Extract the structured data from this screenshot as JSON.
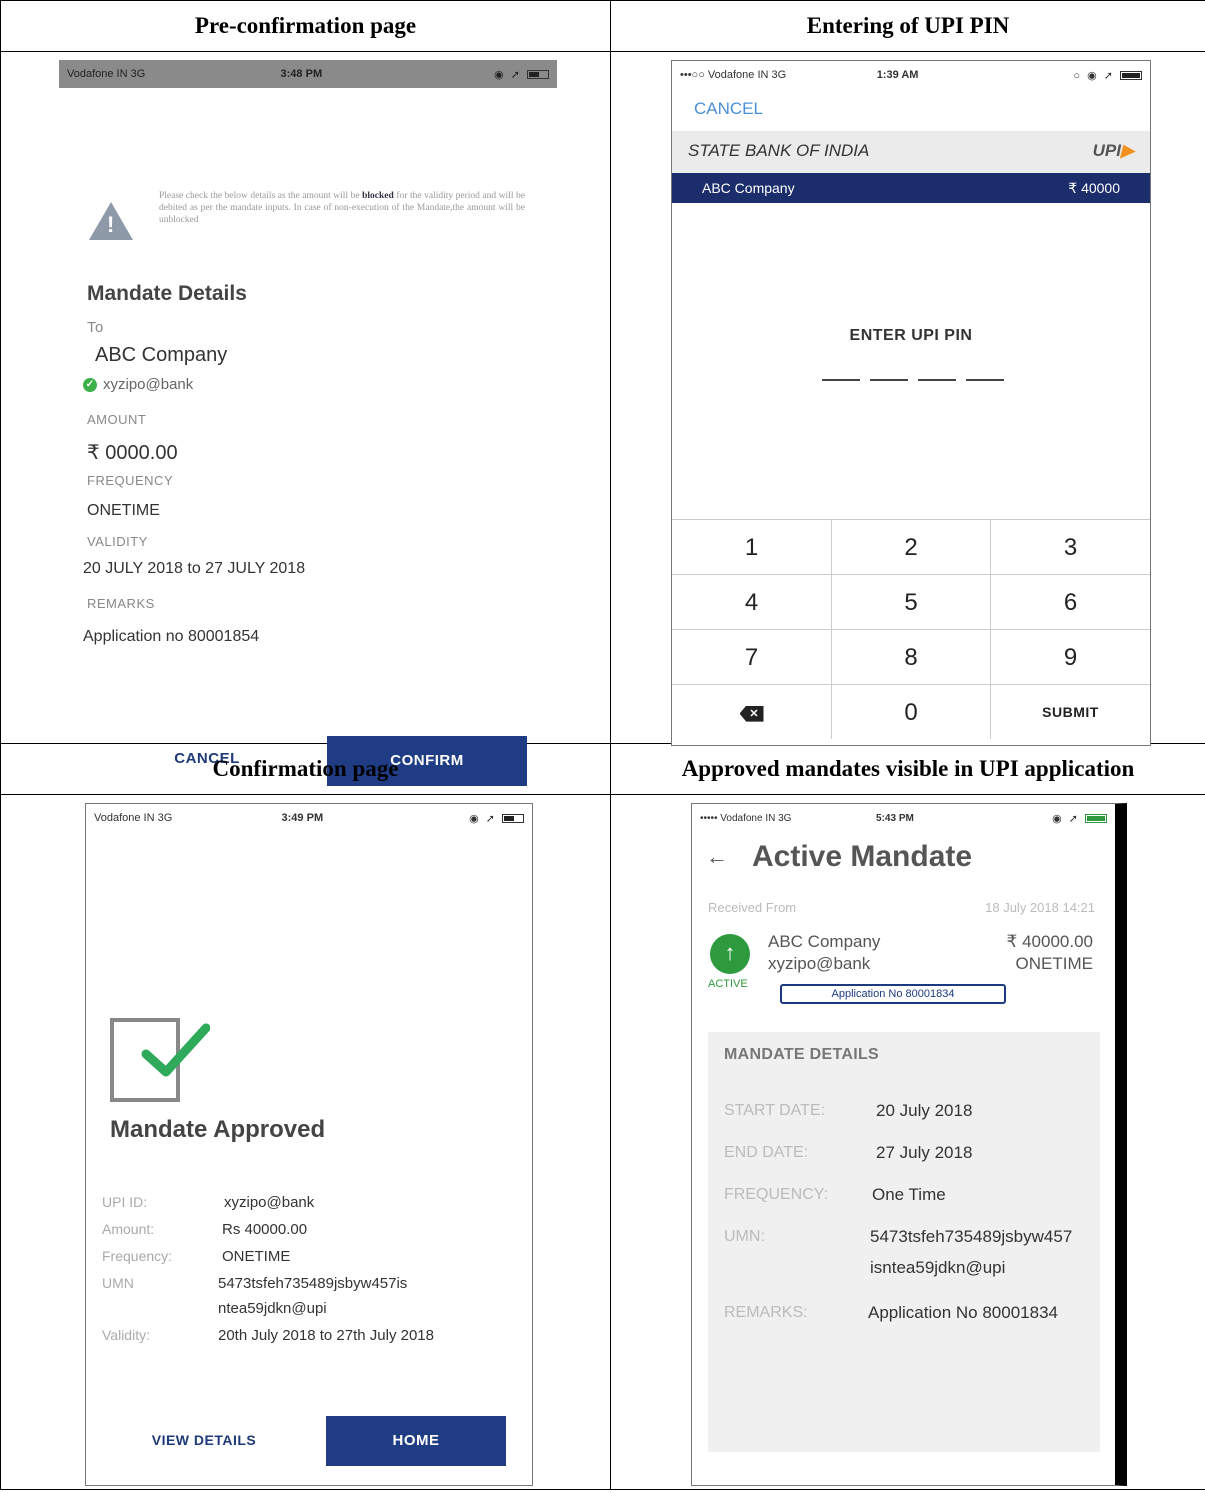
{
  "headers": {
    "pre_confirmation": "Pre-confirmation page",
    "upi_pin": "Entering of UPI PIN",
    "confirmation": "Confirmation page",
    "approved": "Approved mandates visible in UPI application"
  },
  "pre_confirmation": {
    "status": {
      "carrier": "Vodafone IN  3G",
      "time": "3:48 PM"
    },
    "warning_pre": "Please check the below details as the amount will be ",
    "warning_bold": "blocked",
    "warning_post": " for the validity period and will be debited as per the mandate inputs. In case of non-execution of the Mandate,the amount will be unblocked",
    "title": "Mandate Details",
    "to_label": "To",
    "to_value": "ABC Company",
    "vpa": "xyzipo@bank",
    "amount_label": "AMOUNT",
    "amount_value": "₹ 0000.00",
    "frequency_label": "FREQUENCY",
    "frequency_value": "ONETIME",
    "validity_label": "VALIDITY",
    "validity_value": "20 JULY 2018 to 27 JULY 2018",
    "remarks_label": "REMARKS",
    "remarks_value": "Application no 80001854",
    "cancel": "CANCEL",
    "confirm": "CONFIRM"
  },
  "upi_pin": {
    "status": {
      "carrier": "•••○○ Vodafone IN  3G",
      "time": "1:39 AM"
    },
    "cancel": "CANCEL",
    "bank": "STATE BANK OF INDIA",
    "upi_logo": "UPI",
    "payee": "ABC Company",
    "amount": "₹ 40000",
    "enter_pin": "ENTER UPI PIN",
    "keys": [
      "1",
      "2",
      "3",
      "4",
      "5",
      "6",
      "7",
      "8",
      "9",
      "",
      "0",
      "SUBMIT"
    ]
  },
  "confirmation": {
    "status": {
      "carrier": "Vodafone IN  3G",
      "time": "3:49 PM"
    },
    "title": "Mandate Approved",
    "rows": [
      {
        "k": "UPI ID:",
        "v": "xyzipo@bank"
      },
      {
        "k": "Amount:",
        "v": "Rs 40000.00"
      },
      {
        "k": "Frequency:",
        "v": "ONETIME"
      },
      {
        "k": "UMN",
        "v": "5473tsfeh735489jsbyw457is"
      },
      {
        "k": "",
        "v": "ntea59jdkn@upi"
      },
      {
        "k": "Validity:",
        "v": "20th July 2018 to 27th July 2018"
      }
    ],
    "view_details": "VIEW DETAILS",
    "home": "HOME"
  },
  "approved": {
    "status": {
      "carrier": "••••• Vodafone IN  3G",
      "time": "5:43 PM"
    },
    "title": "Active Mandate",
    "received_label": "Received From",
    "received_date": "18 July 2018 14:21",
    "payee": "ABC Company",
    "vpa": "xyzipo@bank",
    "amount": "₹ 40000.00",
    "frequency": "ONETIME",
    "status_label": "ACTIVE",
    "application": "Application No 80001834",
    "details_title": "MANDATE DETAILS",
    "details": [
      {
        "k": "START DATE:",
        "v": "20 July 2018"
      },
      {
        "k": "END DATE:",
        "v": "27 July 2018"
      },
      {
        "k": "FREQUENCY:",
        "v": "One Time"
      },
      {
        "k": "UMN:",
        "v": "5473tsfeh735489jsbyw457"
      },
      {
        "k": "",
        "v": "isntea59jdkn@upi"
      },
      {
        "k": "REMARKS:",
        "v": "Application No 80001834"
      }
    ]
  },
  "colors": {
    "primary": "#1f3c84",
    "success": "#2e9a3e",
    "link": "#4a90d8",
    "upi_accent": "#f29020"
  }
}
